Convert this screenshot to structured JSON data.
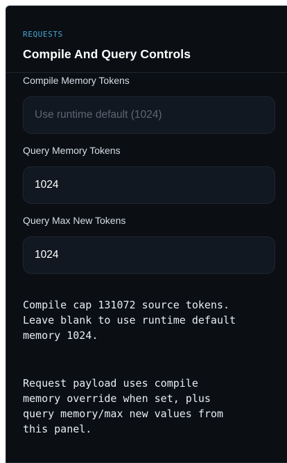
{
  "panel": {
    "kicker": "REQUESTS",
    "title": "Compile And Query Controls"
  },
  "fields": {
    "compile_memory": {
      "label": "Compile Memory Tokens",
      "value": "",
      "placeholder": "Use runtime default (1024)"
    },
    "query_memory": {
      "label": "Query Memory Tokens",
      "value": "1024",
      "placeholder": ""
    },
    "query_max_new": {
      "label": "Query Max New Tokens",
      "value": "1024",
      "placeholder": ""
    }
  },
  "notes": {
    "compile_cap": "Compile cap 131072 source tokens.\nLeave blank to use runtime default\nmemory 1024.",
    "payload": "Request payload uses compile\nmemory override when set, plus\nquery memory/max new values from\nthis panel."
  },
  "colors": {
    "panel_bg": "#0b0f14",
    "input_bg": "#111821",
    "accent": "#43a7cf",
    "text": "#ffffff"
  }
}
